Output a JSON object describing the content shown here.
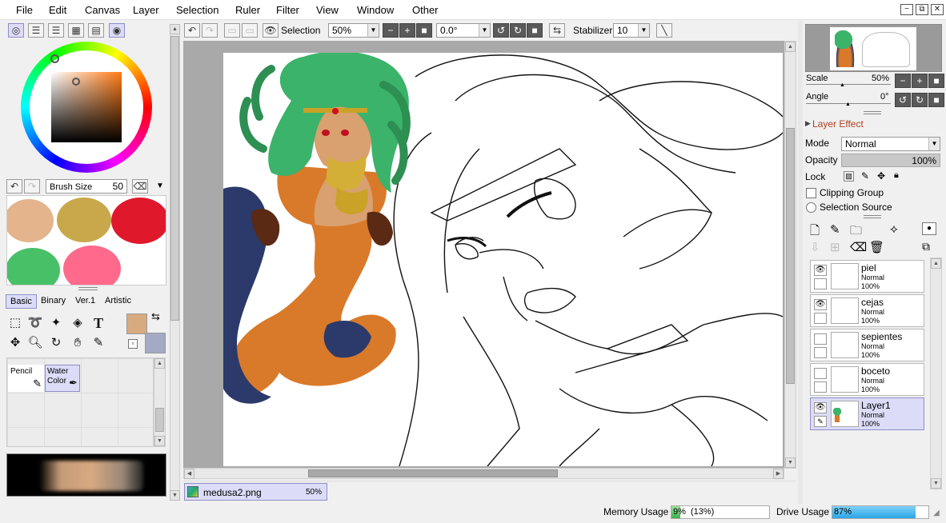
{
  "menu": [
    "File",
    "Edit",
    "Canvas",
    "Layer",
    "Selection",
    "Ruler",
    "Filter",
    "View",
    "Window",
    "Other"
  ],
  "window_buttons": [
    "−",
    "⧉",
    "✕"
  ],
  "toolbar": {
    "selection_label": "Selection",
    "zoom": "50%",
    "rotation": "0.0°",
    "stabilizer_label": "Stabilizer",
    "stabilizer_value": "10"
  },
  "brush": {
    "size_label": "Brush Size",
    "size_value": "50"
  },
  "swatch_colors": [
    "#e4b48c",
    "#c8a84a",
    "#e0182c",
    "#48c068",
    "#ff6a8c"
  ],
  "tool_tabs": [
    "Basic",
    "Binary",
    "Ver.1",
    "Artistic"
  ],
  "primary_color": "#d8aa80",
  "secondary_color": "#a4a9c4",
  "brush_tools": [
    {
      "name": "Pencil"
    },
    {
      "name": "Water Color"
    }
  ],
  "document": {
    "tab_name": "medusa2.png",
    "tab_zoom": "50%"
  },
  "navigator": {
    "scale_label": "Scale",
    "scale_value": "50%",
    "angle_label": "Angle",
    "angle_value": "0°"
  },
  "layer_panel": {
    "layer_effect": "Layer Effect",
    "mode_label": "Mode",
    "mode_value": "Normal",
    "opacity_label": "Opacity",
    "opacity_value": "100%",
    "lock_label": "Lock",
    "clipping_group": "Clipping Group",
    "selection_source": "Selection Source"
  },
  "layers": [
    {
      "name": "piel",
      "mode": "Normal",
      "opacity": "100%",
      "visible": true,
      "selected": false
    },
    {
      "name": "cejas",
      "mode": "Normal",
      "opacity": "100%",
      "visible": true,
      "selected": false
    },
    {
      "name": "sepientes",
      "mode": "Normal",
      "opacity": "100%",
      "visible": false,
      "selected": false
    },
    {
      "name": "boceto",
      "mode": "Normal",
      "opacity": "100%",
      "visible": false,
      "selected": false
    },
    {
      "name": "Layer1",
      "mode": "Normal",
      "opacity": "100%",
      "visible": true,
      "selected": true
    }
  ],
  "status": {
    "memory_label": "Memory Usage",
    "memory_value": "9%",
    "memory_extra": "(13%)",
    "drive_label": "Drive Usage",
    "drive_value": "87%"
  }
}
